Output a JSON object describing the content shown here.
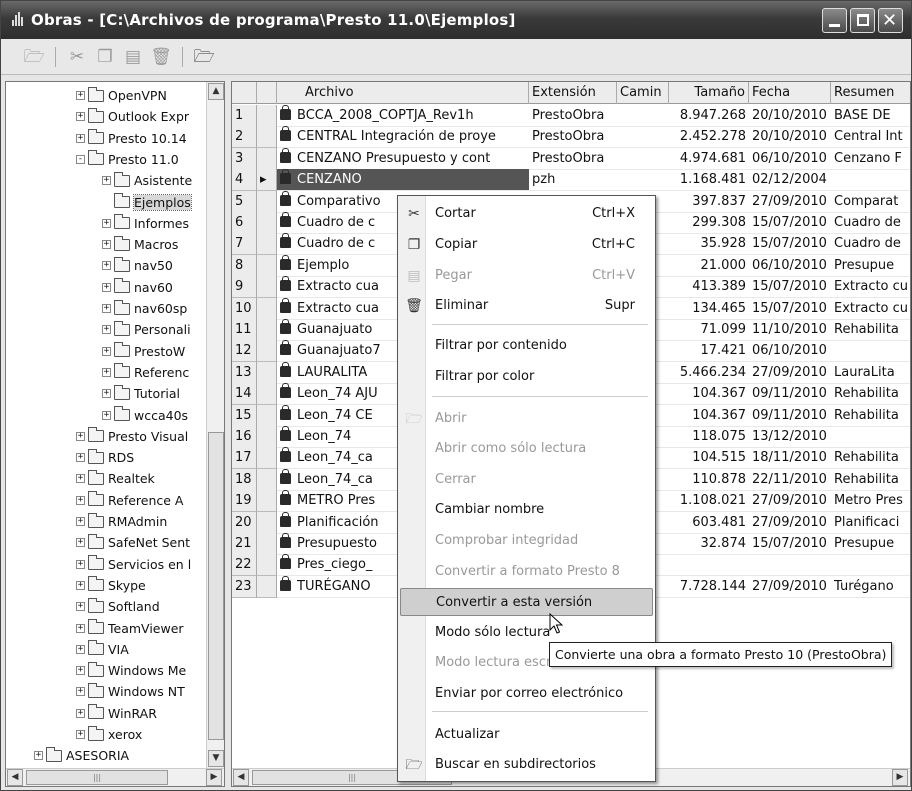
{
  "window": {
    "title": "Obras - [C:\\Archivos de programa\\Presto 11.0\\Ejemplos]"
  },
  "toolbar": {
    "icons": [
      "folder-open-icon",
      "cut-icon",
      "copy-icon",
      "paste-icon",
      "delete-icon",
      "search-folder-icon"
    ]
  },
  "tree": {
    "items": [
      {
        "label": "OpenVPN",
        "level": 2,
        "expander": "+"
      },
      {
        "label": "Outlook Expr",
        "level": 2,
        "expander": "+"
      },
      {
        "label": "Presto 10.14",
        "level": 2,
        "expander": "+"
      },
      {
        "label": "Presto 11.0",
        "level": 2,
        "expander": "-"
      },
      {
        "label": "Asistente",
        "level": 3,
        "expander": "+"
      },
      {
        "label": "Ejemplos",
        "level": 3,
        "expander": "",
        "selected": true
      },
      {
        "label": "Informes",
        "level": 3,
        "expander": "+"
      },
      {
        "label": "Macros",
        "level": 3,
        "expander": "+"
      },
      {
        "label": "nav50",
        "level": 3,
        "expander": "+"
      },
      {
        "label": "nav60",
        "level": 3,
        "expander": "+"
      },
      {
        "label": "nav60sp",
        "level": 3,
        "expander": "+"
      },
      {
        "label": "Personali",
        "level": 3,
        "expander": "+"
      },
      {
        "label": "PrestoW",
        "level": 3,
        "expander": "+"
      },
      {
        "label": "Referenc",
        "level": 3,
        "expander": "+"
      },
      {
        "label": "Tutorial",
        "level": 3,
        "expander": "+"
      },
      {
        "label": "wcca40s",
        "level": 3,
        "expander": "+"
      },
      {
        "label": "Presto Visual",
        "level": 2,
        "expander": "+"
      },
      {
        "label": "RDS",
        "level": 2,
        "expander": "+"
      },
      {
        "label": "Realtek",
        "level": 2,
        "expander": "+"
      },
      {
        "label": "Reference A",
        "level": 2,
        "expander": "+"
      },
      {
        "label": "RMAdmin",
        "level": 2,
        "expander": "+"
      },
      {
        "label": "SafeNet Sent",
        "level": 2,
        "expander": "+"
      },
      {
        "label": "Servicios en l",
        "level": 2,
        "expander": "+"
      },
      {
        "label": "Skype",
        "level": 2,
        "expander": "+"
      },
      {
        "label": "Softland",
        "level": 2,
        "expander": "+"
      },
      {
        "label": "TeamViewer",
        "level": 2,
        "expander": "+"
      },
      {
        "label": "VIA",
        "level": 2,
        "expander": "+"
      },
      {
        "label": "Windows Me",
        "level": 2,
        "expander": "+"
      },
      {
        "label": "Windows NT",
        "level": 2,
        "expander": "+"
      },
      {
        "label": "WinRAR",
        "level": 2,
        "expander": "+"
      },
      {
        "label": "xerox",
        "level": 2,
        "expander": "+"
      },
      {
        "label": "ASESORIA",
        "level": 1,
        "expander": "+"
      }
    ]
  },
  "grid": {
    "columns": [
      "Archivo",
      "Extensión",
      "Camin",
      "Tamaño",
      "Fecha",
      "Resumen"
    ],
    "rows": [
      {
        "num": "1",
        "archivo": "BCCA_2008_COPTJA_Rev1h",
        "ext": "PrestoObra",
        "size": "8.947.268",
        "date": "20/10/2010",
        "resumen": "BASE DE"
      },
      {
        "num": "2",
        "archivo": "CENTRAL Integración de proye",
        "ext": "PrestoObra",
        "size": "2.452.278",
        "date": "20/10/2010",
        "resumen": "Central Int"
      },
      {
        "num": "3",
        "archivo": "CENZANO Presupuesto y cont",
        "ext": "PrestoObra",
        "size": "4.974.681",
        "date": "06/10/2010",
        "resumen": "Cenzano F"
      },
      {
        "num": "4",
        "archivo": "CENZANO",
        "ext": "pzh",
        "size": "1.168.481",
        "date": "02/12/2004",
        "resumen": "",
        "selected": true
      },
      {
        "num": "5",
        "archivo": "Comparativo",
        "ext": "",
        "size": "397.837",
        "date": "27/09/2010",
        "resumen": "Comparat"
      },
      {
        "num": "6",
        "archivo": "Cuadro de c",
        "ext": "",
        "size": "299.308",
        "date": "15/07/2010",
        "resumen": "Cuadro de"
      },
      {
        "num": "7",
        "archivo": "Cuadro de c",
        "ext": "",
        "size": "35.928",
        "date": "15/07/2010",
        "resumen": "Cuadro de"
      },
      {
        "num": "8",
        "archivo": "Ejemplo",
        "ext": "",
        "size": "21.000",
        "date": "06/10/2010",
        "resumen": "Presupue"
      },
      {
        "num": "9",
        "archivo": "Extracto cua",
        "ext": "",
        "size": "413.389",
        "date": "15/07/2010",
        "resumen": "Extracto cu"
      },
      {
        "num": "10",
        "archivo": "Extracto cua",
        "ext": "",
        "size": "134.465",
        "date": "15/07/2010",
        "resumen": "Extracto cu"
      },
      {
        "num": "11",
        "archivo": "Guanajuato",
        "ext": "",
        "size": "71.099",
        "date": "11/10/2010",
        "resumen": "Rehabilita"
      },
      {
        "num": "12",
        "archivo": "Guanajuato7",
        "ext": "",
        "size": "17.421",
        "date": "06/10/2010",
        "resumen": ""
      },
      {
        "num": "13",
        "archivo": "LAURALITA",
        "ext": "",
        "size": "5.466.234",
        "date": "27/09/2010",
        "resumen": "LauraLita"
      },
      {
        "num": "14",
        "archivo": "Leon_74 AJU",
        "ext": "",
        "size": "104.367",
        "date": "09/11/2010",
        "resumen": "Rehabilita"
      },
      {
        "num": "15",
        "archivo": "Leon_74 CE",
        "ext": "",
        "size": "104.367",
        "date": "09/11/2010",
        "resumen": "Rehabilita"
      },
      {
        "num": "16",
        "archivo": "Leon_74",
        "ext": "",
        "size": "118.075",
        "date": "13/12/2010",
        "resumen": ""
      },
      {
        "num": "17",
        "archivo": "Leon_74_ca",
        "ext": "",
        "size": "104.515",
        "date": "18/11/2010",
        "resumen": "Rehabilita"
      },
      {
        "num": "18",
        "archivo": "Leon_74_ca",
        "ext": "",
        "size": "110.878",
        "date": "22/11/2010",
        "resumen": "Rehabilita"
      },
      {
        "num": "19",
        "archivo": "METRO Pres",
        "ext": "",
        "size": "1.108.021",
        "date": "27/09/2010",
        "resumen": "Metro Pres"
      },
      {
        "num": "20",
        "archivo": "Planificación",
        "ext": "",
        "size": "603.481",
        "date": "27/09/2010",
        "resumen": "Planificaci"
      },
      {
        "num": "21",
        "archivo": "Presupuesto",
        "ext": "",
        "size": "32.874",
        "date": "15/07/2010",
        "resumen": "Presupue"
      },
      {
        "num": "22",
        "archivo": "Pres_ciego_",
        "ext": "",
        "size": "",
        "date": "",
        "resumen": ""
      },
      {
        "num": "23",
        "archivo": "TURÉGANO",
        "ext": "",
        "size": "7.728.144",
        "date": "27/09/2010",
        "resumen": "Turégano"
      }
    ]
  },
  "context_menu": {
    "items": [
      {
        "label": "Cortar",
        "shortcut": "Ctrl+X",
        "icon": "cut-icon",
        "disabled": false
      },
      {
        "label": "Copiar",
        "shortcut": "Ctrl+C",
        "icon": "copy-icon",
        "disabled": false
      },
      {
        "label": "Pegar",
        "shortcut": "Ctrl+V",
        "icon": "paste-icon",
        "disabled": true
      },
      {
        "label": "Eliminar",
        "shortcut": "Supr",
        "icon": "delete-icon",
        "disabled": false
      },
      {
        "label": "Filtrar por contenido",
        "shortcut": "",
        "icon": "",
        "disabled": false
      },
      {
        "label": "Filtrar por color",
        "shortcut": "",
        "icon": "",
        "disabled": false
      },
      {
        "label": "Abrir",
        "shortcut": "",
        "icon": "folder-open-icon",
        "disabled": true
      },
      {
        "label": "Abrir como sólo lectura",
        "shortcut": "",
        "icon": "",
        "disabled": true
      },
      {
        "label": "Cerrar",
        "shortcut": "",
        "icon": "",
        "disabled": true
      },
      {
        "label": "Cambiar nombre",
        "shortcut": "",
        "icon": "",
        "disabled": false
      },
      {
        "label": "Comprobar integridad",
        "shortcut": "",
        "icon": "",
        "disabled": true
      },
      {
        "label": "Convertir a formato Presto 8",
        "shortcut": "",
        "icon": "",
        "disabled": true
      },
      {
        "label": "Convertir a esta versión",
        "shortcut": "",
        "icon": "",
        "disabled": false,
        "highlighted": true
      },
      {
        "label": "Modo sólo lectura",
        "shortcut": "",
        "icon": "",
        "disabled": false
      },
      {
        "label": "Modo lectura escritura",
        "shortcut": "",
        "icon": "",
        "disabled": true
      },
      {
        "label": "Enviar por correo electrónico",
        "shortcut": "",
        "icon": "",
        "disabled": false
      },
      {
        "label": "Actualizar",
        "shortcut": "",
        "icon": "",
        "disabled": false
      },
      {
        "label": "Buscar en subdirectorios",
        "shortcut": "",
        "icon": "search-folder-icon",
        "disabled": false
      }
    ]
  },
  "tooltip": {
    "text": "Convierte una obra a formato Presto 10 (PrestoObra)"
  }
}
